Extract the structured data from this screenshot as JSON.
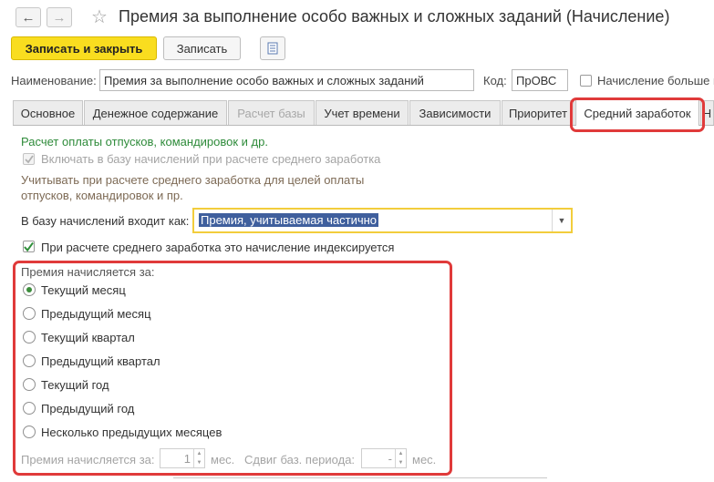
{
  "window": {
    "title": "Премия за выполнение особо важных и сложных заданий (Начисление)",
    "back_icon": "arrow-left-icon",
    "forward_icon": "arrow-right-icon",
    "favorite_icon": "star-icon"
  },
  "toolbar": {
    "save_close_label": "Записать и закрыть",
    "save_label": "Записать",
    "report_icon": "document-list-icon"
  },
  "header": {
    "name_label": "Наименование:",
    "name_value": "Премия за выполнение особо важных и сложных заданий",
    "code_label": "Код:",
    "code_value": "ПрОВС",
    "extra_checkbox_label": "Начисление больше н"
  },
  "tabs": [
    {
      "label": "Основное",
      "state": "normal"
    },
    {
      "label": "Денежное содержание",
      "state": "normal"
    },
    {
      "label": "Расчет базы",
      "state": "disabled"
    },
    {
      "label": "Учет времени",
      "state": "normal"
    },
    {
      "label": "Зависимости",
      "state": "normal"
    },
    {
      "label": "Приоритет",
      "state": "normal"
    },
    {
      "label": "Средний заработок",
      "state": "active"
    },
    {
      "label": "Н",
      "state": "normal"
    }
  ],
  "average_earnings": {
    "section_title": "Расчет оплаты отпусков, командировок и др.",
    "include_in_base_label": "Включать в базу начислений при расчете среднего заработка",
    "include_in_base_checked": true,
    "note_line1": "Учитывать при расчете среднего заработка для целей оплаты",
    "note_line2": "отпусков, командировок и пр.",
    "base_entry_label": "В базу начислений входит как:",
    "base_entry_value": "Премия, учитываемая частично",
    "indexed_label": "При расчете среднего заработка это начисление индексируется",
    "indexed_checked": true,
    "accrual_period_title": "Премия начисляется за:",
    "accrual_period_options": [
      "Текущий месяц",
      "Предыдущий месяц",
      "Текущий квартал",
      "Предыдущий квартал",
      "Текущий год",
      "Предыдущий год",
      "Несколько предыдущих месяцев"
    ],
    "accrual_period_selected": "Текущий месяц",
    "months_label": "Премия начисляется за:",
    "months_value": "1",
    "months_unit": "мес.",
    "shift_label": "Сдвиг баз. периода:",
    "shift_value": "-",
    "shift_unit": "мес."
  },
  "colors": {
    "accent_yellow": "#f9dd1f",
    "highlight_red": "#e03a3a",
    "section_green": "#2e8b3a",
    "selection_blue": "#3f5f9d"
  }
}
